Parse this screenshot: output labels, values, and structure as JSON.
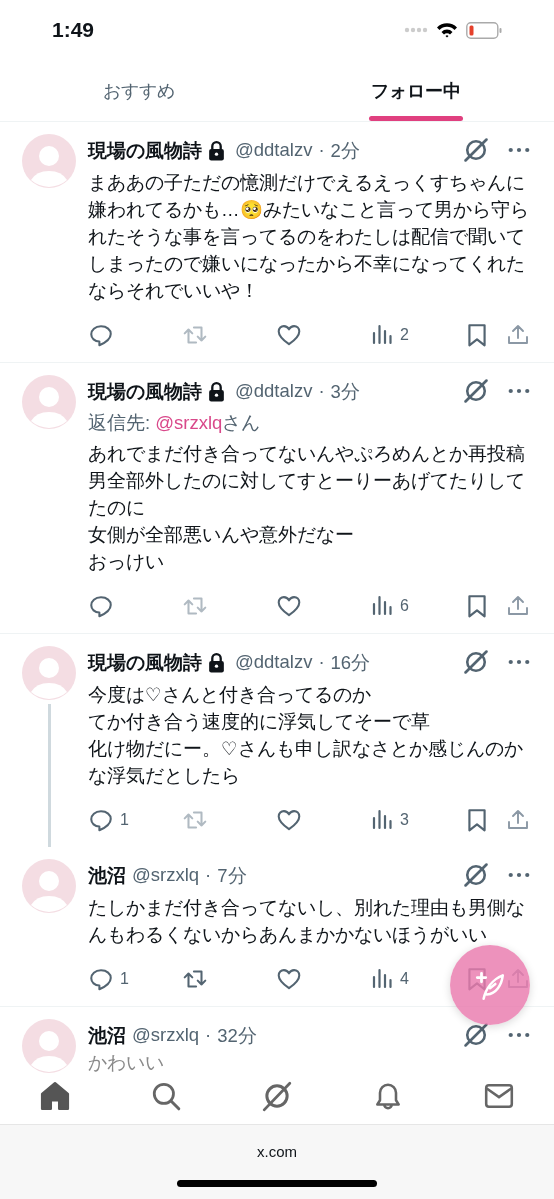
{
  "status_bar": {
    "time": "1:49"
  },
  "tabs": [
    {
      "label": "おすすめ",
      "selected": false
    },
    {
      "label": "フォロー中",
      "selected": true
    }
  ],
  "posts": [
    {
      "name": "現場の風物詩",
      "protected": true,
      "handle": "@ddtalzv",
      "dot": "·",
      "time": "2分",
      "lines": [
        "まああの子ただの憶測だけでえるえっくすちゃんに嫌われてるかも…🥺みたいなこと言って男から守られたそうな事を言ってるのをわたしは配信で聞いてしまったので嫌いになったから不幸になってくれたならそれでいいや！"
      ],
      "views": "2",
      "retweet_disabled": true,
      "thread_continues": false
    },
    {
      "name": "現場の風物詩",
      "protected": true,
      "handle": "@ddtalzv",
      "dot": "·",
      "time": "3分",
      "reply_to": {
        "label": "返信先:",
        "handle": "@srzxlq",
        "suffix": "さん"
      },
      "lines": [
        "あれでまだ付き合ってないんやぷろめんとか再投稿",
        "男全部外したのに対してすとーりーあげてたりしてたのに",
        "女側が全部悪いんや意外だなー",
        "おっけい"
      ],
      "views": "6",
      "retweet_disabled": true,
      "thread_continues": false
    },
    {
      "name": "現場の風物詩",
      "protected": true,
      "handle": "@ddtalzv",
      "dot": "·",
      "time": "16分",
      "lines": [
        "今度は♡さんと付き合ってるのか",
        "てか付き合う速度的に浮気してそーで草",
        "化け物だにー。♡さんも申し訳なさとか感じんのかな浮気だとしたら"
      ],
      "replies": "1",
      "views": "3",
      "retweet_disabled": true,
      "thread_continues": true
    },
    {
      "name": "池沼",
      "protected": false,
      "handle": "@srzxlq",
      "dot": "·",
      "time": "7分",
      "lines": [
        "たしかまだ付き合ってないし、別れた理由も男側なんもわるくないからあんまかかないほうがいい"
      ],
      "replies": "1",
      "views": "4",
      "retweet_disabled": false,
      "thread_continues": false
    },
    {
      "name": "池沼",
      "protected": false,
      "handle": "@srzxlq",
      "dot": "·",
      "time": "32分",
      "lines": [
        "かわいい"
      ],
      "faded": true,
      "thread_continues": false
    }
  ],
  "bottom_nav": [
    {
      "kind": "home",
      "selected": true
    },
    {
      "kind": "search",
      "selected": false
    },
    {
      "kind": "grok",
      "selected": false
    },
    {
      "kind": "notifications",
      "selected": false
    },
    {
      "kind": "messages",
      "selected": false
    }
  ],
  "browser": {
    "address": "x.com"
  }
}
